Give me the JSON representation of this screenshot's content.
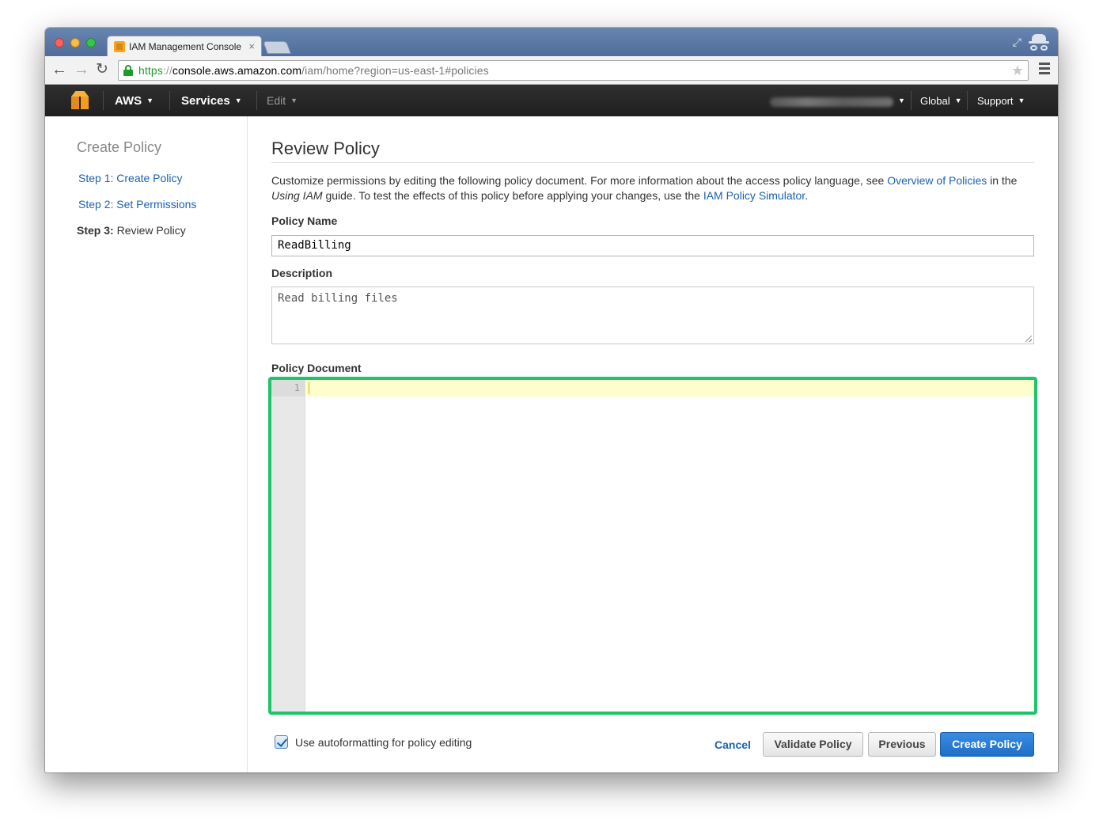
{
  "browser": {
    "tab_title": "IAM Management Console",
    "tab_close": "×",
    "url_scheme": "https",
    "url_sep": "://",
    "url_host": "console.aws.amazon.com",
    "url_path": "/iam/home?region=us-east-1#policies",
    "back_glyph": "←",
    "forward_glyph": "→",
    "reload_glyph": "↻",
    "star_glyph": "★",
    "expand_glyph": "⤢",
    "icons": [
      "back-arrow-icon",
      "forward-arrow-icon",
      "reload-icon",
      "lock-icon",
      "bookmark-star-icon",
      "menu-icon",
      "incognito-icon"
    ]
  },
  "awsnav": {
    "aws_label": "AWS",
    "services_label": "Services",
    "edit_label": "Edit",
    "global_label": "Global",
    "support_label": "Support",
    "caret": "▼"
  },
  "sidebar": {
    "title": "Create Policy",
    "step1": "Step 1: Create Policy",
    "step2": "Step 2: Set Permissions",
    "step3_prefix": "Step 3:",
    "step3_label": "Review Policy"
  },
  "main": {
    "title": "Review Policy",
    "intro_part1": "Customize permissions by editing the following policy document. For more information about the access policy language, see ",
    "intro_link1": "Overview of Policies",
    "intro_part2": " in the ",
    "intro_italic": "Using IAM",
    "intro_part3": " guide. To test the effects of this policy before applying your changes, use the ",
    "intro_link2": "IAM Policy Simulator",
    "intro_part4": ".",
    "policy_name_label": "Policy Name",
    "policy_name_value": "ReadBilling",
    "description_label": "Description",
    "description_value": "Read billing files",
    "policy_document_label": "Policy Document",
    "editor_line_number": "1",
    "autoformat_label": "Use autoformatting for policy editing",
    "autoformat_checked": true,
    "cancel_label": "Cancel",
    "validate_label": "Validate Policy",
    "previous_label": "Previous",
    "create_label": "Create Policy"
  },
  "colors": {
    "link_blue": "#1b62b3",
    "primary_button": "#1d6ec8",
    "editor_highlight_border": "#1dc46a",
    "aws_bar": "#232323"
  }
}
